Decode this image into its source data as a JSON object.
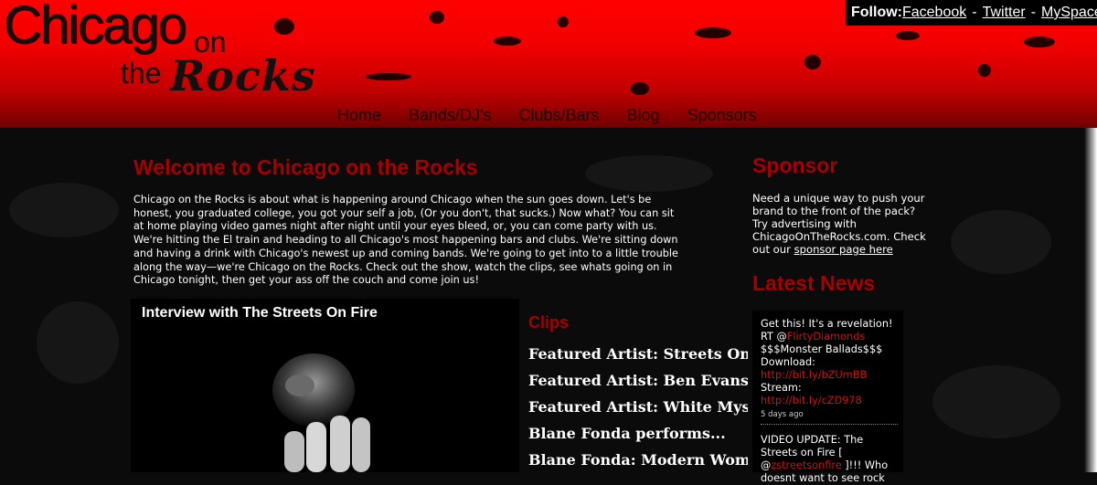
{
  "logo": {
    "line1": "Chicago",
    "on": "on",
    "the": "the",
    "rocks": "Rocks"
  },
  "follow": {
    "label": "Follow:",
    "links": [
      "Facebook",
      "Twitter",
      "MySpace"
    ],
    "separator": "-"
  },
  "nav": [
    "Home",
    "Bands/DJ's",
    "Clubs/Bars",
    "Blog",
    "Sponsors"
  ],
  "welcome": {
    "title": "Welcome to Chicago on the Rocks",
    "text": "Chicago on the Rocks is about what is happening around Chicago when the sun goes down. Let's be honest, you graduated college, you got your self a job, (Or you don't, that sucks.) Now what? You can sit at home playing video games night after night until your eyes bleed, or, you can come party with us. We're hitting the El train and heading to all Chicago's most happening bars and clubs. We're sitting down and having a drink with Chicago's newest up and coming bands. We're going to get into to a little trouble along the way—we're Chicago on the Rocks. Check out the show, watch the clips, see whats going on in Chicago tonight, then get your ass off the couch and come join us!"
  },
  "video": {
    "title": "Interview with The Streets On Fire"
  },
  "clips": {
    "title": "Clips",
    "items": [
      "Featured Artist: Streets On...",
      "Featured Artist: Ben Evans",
      "Featured Artist: White Mystery",
      "Blane Fonda performs...",
      "Blane Fonda: Modern Woman"
    ]
  },
  "sponsor": {
    "title": "Sponsor",
    "text": "Need a unique way to push your brand to the front of the pack? Try advertising with ChicagoOnTheRocks.com. Check out our ",
    "link": "sponsor page here"
  },
  "news": {
    "title": "Latest News",
    "tweets": [
      {
        "pre": "Get this! It's a revelation! RT @",
        "handle": "FlirtyDiamonds",
        "mid": " $$$Monster Ballads$$$ Download: ",
        "link1": "http://bit.ly/bZUmBB",
        "mid2": " Stream: ",
        "link2": "http://bit.ly/cZD978",
        "ago": "5 days ago"
      },
      {
        "pre": "VIDEO UPDATE: The Streets on Fire [ @",
        "handle": "zstreetsonfire",
        "mid": " ]!!! Who doesnt want to see rock",
        "ago": ""
      }
    ]
  },
  "colors": {
    "header_red": "#ff0000",
    "title_red": "#a70000",
    "background": "#0b0b0b"
  }
}
